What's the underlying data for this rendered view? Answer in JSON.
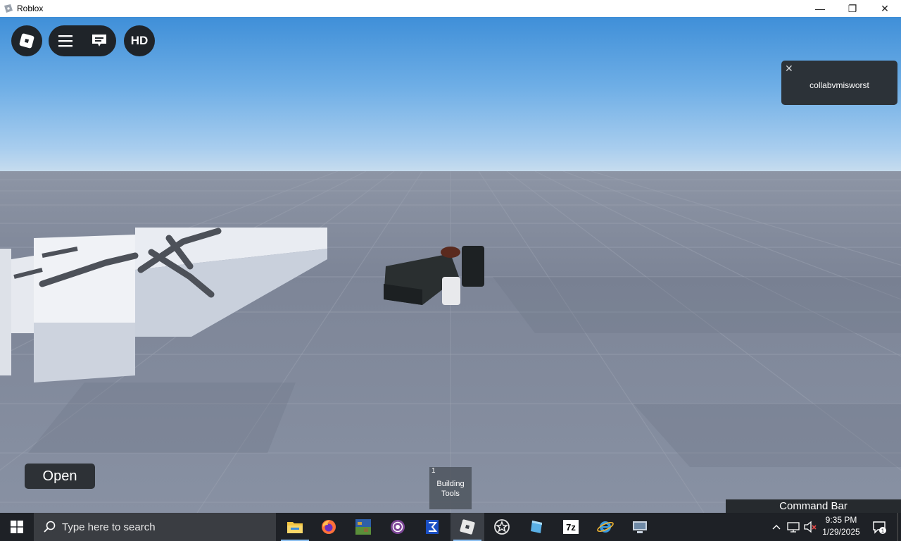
{
  "window": {
    "title": "Roblox",
    "minimize_glyph": "—",
    "maximize_glyph": "❐",
    "close_glyph": "✕"
  },
  "game": {
    "hd_label": "HD",
    "notification": {
      "close_glyph": "✕",
      "text": "collabvmisworst"
    },
    "open_button_label": "Open",
    "hotbar": [
      {
        "slot": "1",
        "label": "Building\nTools"
      }
    ],
    "command_bar_label": "Command Bar"
  },
  "taskbar": {
    "search_placeholder": "Type here to search",
    "pinned": [
      {
        "name": "file-explorer-icon",
        "color": "#f4c542"
      },
      {
        "name": "firefox-icon",
        "color": "#ff7139"
      },
      {
        "name": "minecraft-launcher-icon",
        "color": "#4a8a3a"
      },
      {
        "name": "tor-browser-icon",
        "color": "#7e4798"
      },
      {
        "name": "notepad-app-icon",
        "color": "#1a4fc4"
      },
      {
        "name": "roblox-app-icon",
        "color": "#e8e8e8"
      },
      {
        "name": "roblox-studio-star-icon",
        "color": "#e8e8e8"
      },
      {
        "name": "paint-3d-icon",
        "color": "#5ab0e6"
      },
      {
        "name": "seven-zip-icon",
        "color": "#ffffff"
      },
      {
        "name": "internet-explorer-icon",
        "color": "#3a9ae0"
      },
      {
        "name": "remote-desktop-icon",
        "color": "#c9d3de"
      }
    ],
    "seven_zip_label": "7z",
    "tray": {
      "up_arrow_glyph": "^"
    },
    "clock": {
      "time": "9:35 PM",
      "date": "1/29/2025"
    },
    "notification_count": "1"
  },
  "colors": {
    "sky_top": "#3f8fd8",
    "ground": "#8f97a8",
    "ui_dark": "#1f2429",
    "taskbar": "#1e2126"
  }
}
